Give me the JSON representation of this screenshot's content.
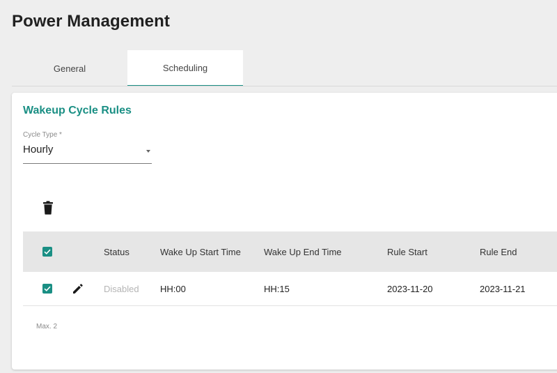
{
  "page": {
    "title": "Power Management"
  },
  "tabs": [
    {
      "label": "General",
      "active": false
    },
    {
      "label": "Scheduling",
      "active": true
    }
  ],
  "section": {
    "title": "Wakeup Cycle Rules",
    "cycle_type": {
      "label": "Cycle Type *",
      "value": "Hourly"
    }
  },
  "table": {
    "headers": [
      "Status",
      "Wake Up Start Time",
      "Wake Up End Time",
      "Rule Start",
      "Rule End"
    ],
    "rows": [
      {
        "checked": true,
        "status": "Disabled",
        "start_time": "HH:00",
        "end_time": "HH:15",
        "rule_start": "2023-11-20",
        "rule_end": "2023-11-21"
      }
    ],
    "footer": "Max. 2"
  },
  "colors": {
    "accent": "#1a8f84",
    "background": "#eeeeee"
  },
  "icons": [
    "trash-icon",
    "edit-icon",
    "checkbox-checked-icon",
    "dropdown-arrow-icon"
  ]
}
